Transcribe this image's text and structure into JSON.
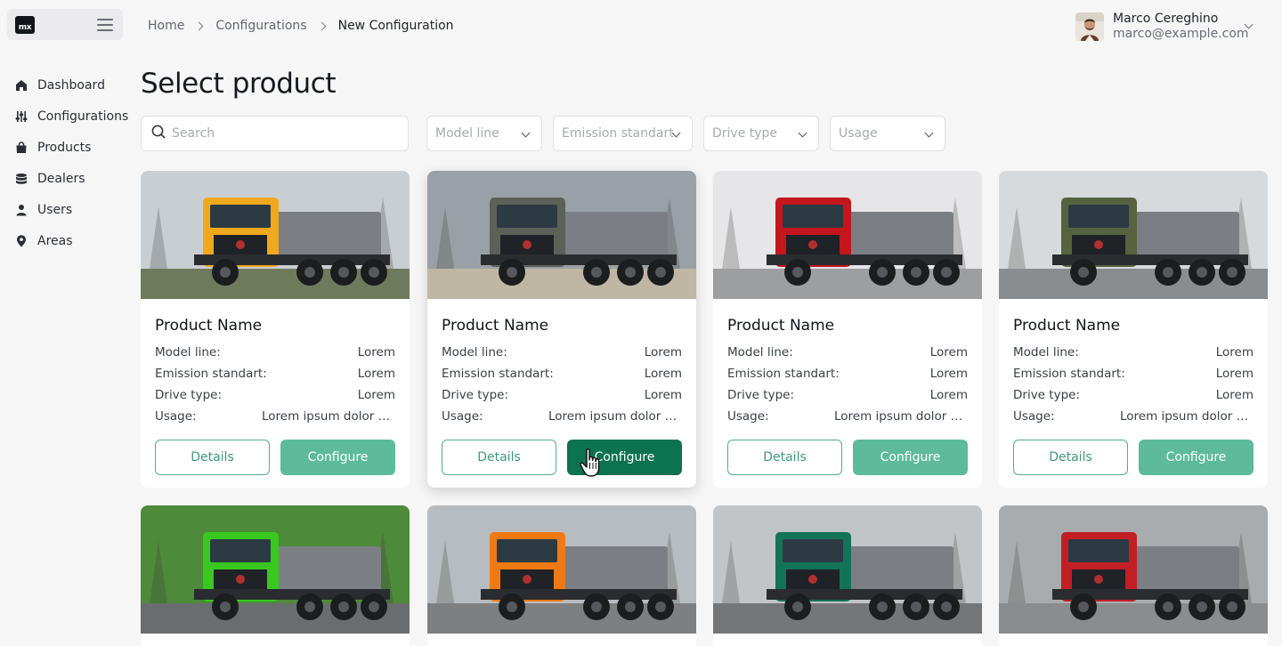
{
  "app": {
    "logo_text": "mx"
  },
  "sidebar": {
    "items": [
      {
        "label": "Dashboard",
        "icon": "home-icon"
      },
      {
        "label": "Configurations",
        "icon": "sliders-icon"
      },
      {
        "label": "Products",
        "icon": "bag-icon"
      },
      {
        "label": "Dealers",
        "icon": "database-icon"
      },
      {
        "label": "Users",
        "icon": "user-icon"
      },
      {
        "label": "Areas",
        "icon": "map-pin-icon"
      }
    ]
  },
  "breadcrumb": {
    "items": [
      "Home",
      "Configurations"
    ],
    "current": "New Configuration"
  },
  "user": {
    "name": "Marco Cereghino",
    "email": "marco@example.com"
  },
  "page": {
    "title": "Select product"
  },
  "filters": {
    "search_placeholder": "Search",
    "dropdowns": [
      "Model line",
      "Emission standart",
      "Drive type",
      "Usage"
    ]
  },
  "card_labels": {
    "model_line": "Model line:",
    "emission": "Emission standart:",
    "drive": "Drive type:",
    "usage": "Usage:",
    "details": "Details",
    "configure": "Configure"
  },
  "products": [
    {
      "name": "Product Name",
      "model_line": "Lorem",
      "emission": "Lorem",
      "drive": "Lorem",
      "usage": "Lorem ipsum dolor sit amet",
      "truck_color": "#f0a81c"
    },
    {
      "name": "Product Name",
      "model_line": "Lorem",
      "emission": "Lorem",
      "drive": "Lorem",
      "usage": "Lorem ipsum dolor sit amet",
      "truck_color": "#5b6157"
    },
    {
      "name": "Product Name",
      "model_line": "Lorem",
      "emission": "Lorem",
      "drive": "Lorem",
      "usage": "Lorem ipsum dolor sit amet",
      "truck_color": "#c4161c"
    },
    {
      "name": "Product Name",
      "model_line": "Lorem",
      "emission": "Lorem",
      "drive": "Lorem",
      "usage": "Lorem ipsum dolor sit amet",
      "truck_color": "#56633f"
    },
    {
      "truck_color": "#38c820"
    },
    {
      "truck_color": "#f07a12"
    },
    {
      "truck_color": "#137356"
    },
    {
      "truck_color": "#c21f25"
    }
  ],
  "colors": {
    "accent": "#5dbb9b",
    "accent_active": "#0c7250",
    "accent_border": "#4fae8f"
  }
}
